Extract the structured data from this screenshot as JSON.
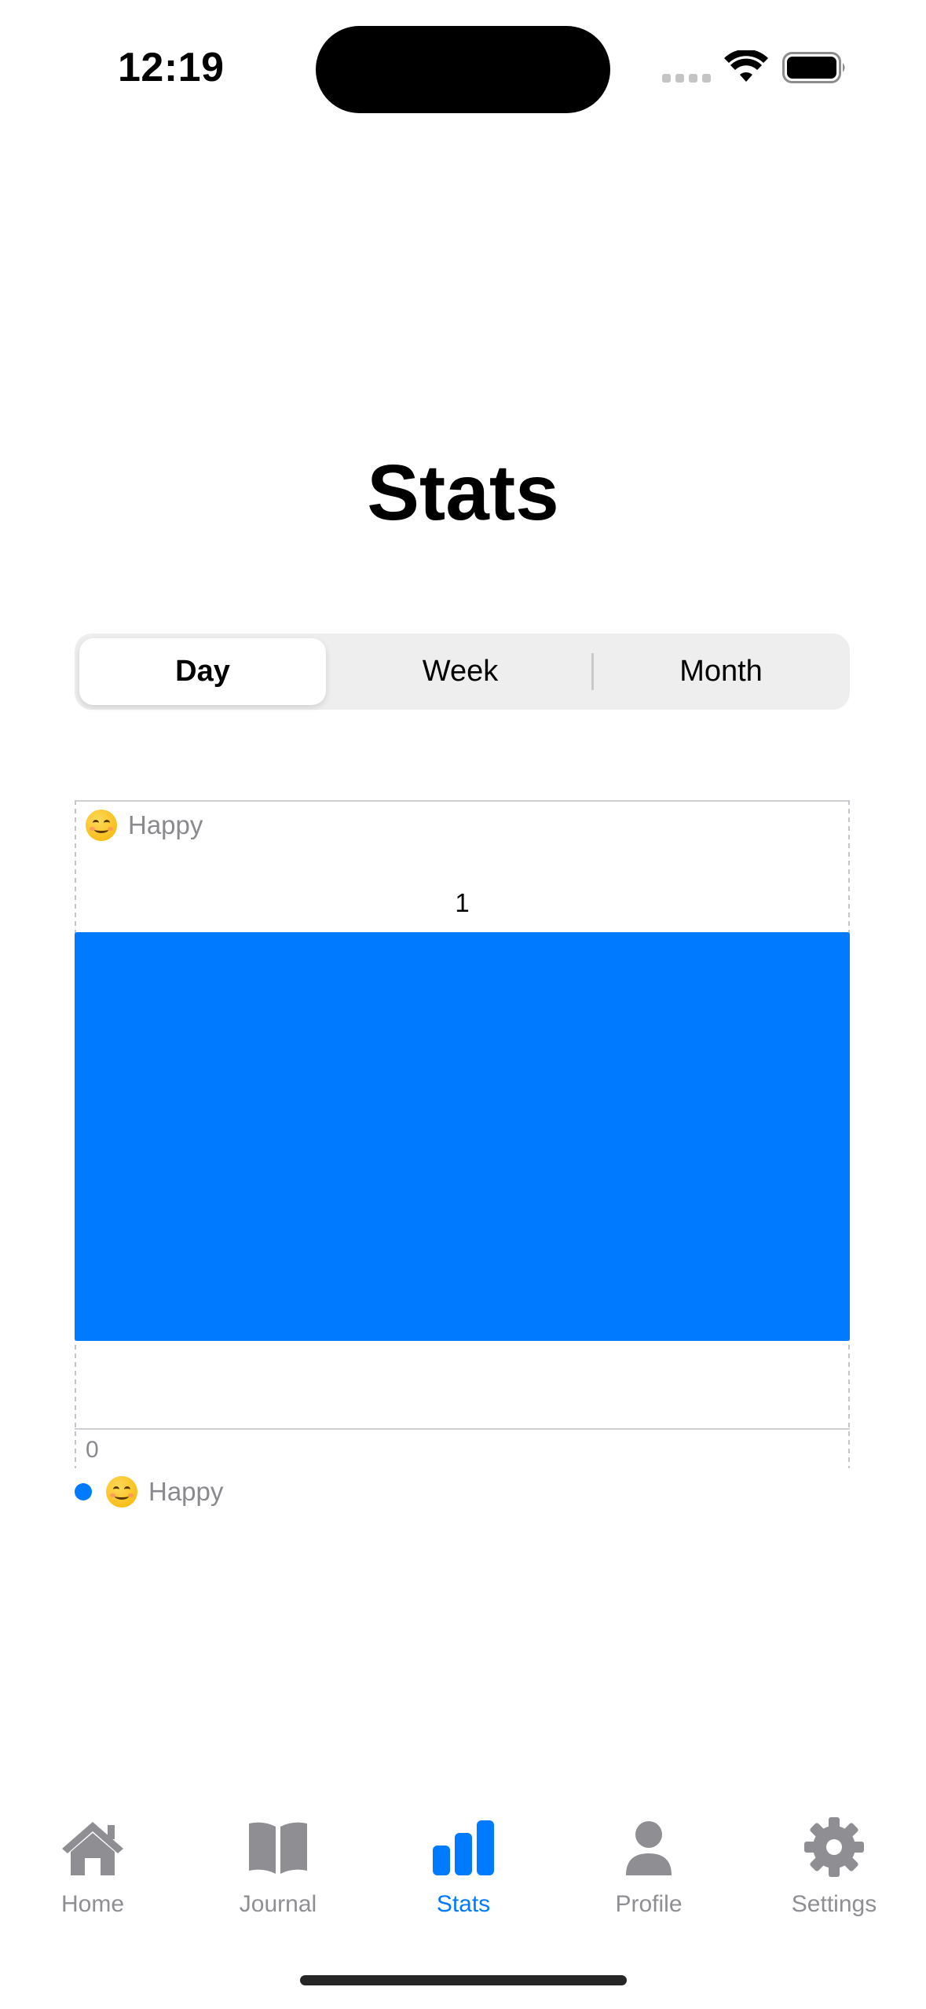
{
  "status_bar": {
    "time": "12:19",
    "icons": [
      "signal-icon",
      "wifi-icon",
      "battery-icon"
    ]
  },
  "page": {
    "title": "Stats"
  },
  "segmented_control": {
    "options": [
      "Day",
      "Week",
      "Month"
    ],
    "selected": "Day"
  },
  "chart_data": {
    "type": "bar",
    "orientation": "horizontal",
    "categories": [
      "😊 Happy"
    ],
    "values": [
      1
    ],
    "data_labels": [
      "1"
    ],
    "x_ticks": [
      "0"
    ],
    "category_label": "Happy",
    "legend": [
      {
        "name": "Happy",
        "icon": "smiling-face-emoji",
        "color": "#007aff"
      }
    ],
    "legend_position": "bottom-left",
    "xlim": [
      0,
      1
    ],
    "bar_color": "#007aff",
    "grid": true
  },
  "tab_bar": {
    "active": "Stats",
    "accent_color": "#007aff",
    "inactive_color": "#8e8e93",
    "items": [
      {
        "label": "Home",
        "icon": "house-icon"
      },
      {
        "label": "Journal",
        "icon": "book-icon"
      },
      {
        "label": "Stats",
        "icon": "bar-chart-icon"
      },
      {
        "label": "Profile",
        "icon": "person-icon"
      },
      {
        "label": "Settings",
        "icon": "gear-icon"
      }
    ]
  }
}
